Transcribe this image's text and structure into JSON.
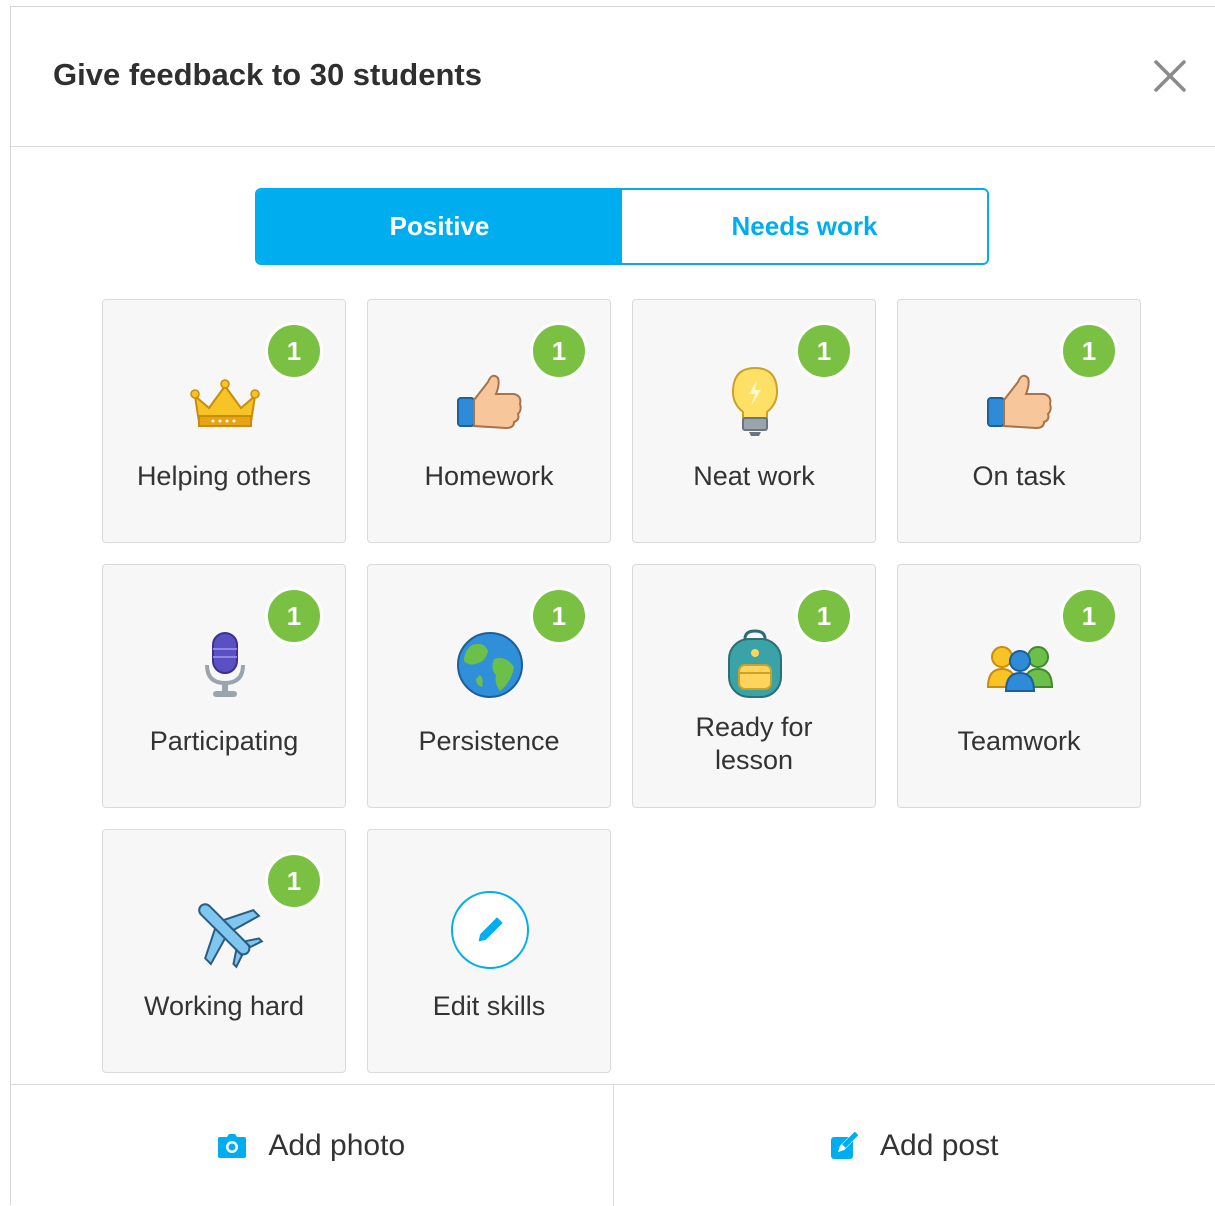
{
  "dialog": {
    "title": "Give feedback to 30 students"
  },
  "tabs": {
    "positive_label": "Positive",
    "needs_work_label": "Needs work",
    "active": "Positive"
  },
  "skills": [
    {
      "label": "Helping others",
      "icon": "crown-icon",
      "count": "1"
    },
    {
      "label": "Homework",
      "icon": "thumbs-up-icon",
      "count": "1"
    },
    {
      "label": "Neat work",
      "icon": "lightbulb-icon",
      "count": "1"
    },
    {
      "label": "On task",
      "icon": "thumbs-up-icon",
      "count": "1"
    },
    {
      "label": "Participating",
      "icon": "microphone-icon",
      "count": "1"
    },
    {
      "label": "Persistence",
      "icon": "globe-icon",
      "count": "1"
    },
    {
      "label": "Ready for lesson",
      "icon": "backpack-icon",
      "count": "1"
    },
    {
      "label": "Teamwork",
      "icon": "team-icon",
      "count": "1"
    },
    {
      "label": "Working hard",
      "icon": "airplane-icon",
      "count": "1"
    }
  ],
  "edit_skills": {
    "label": "Edit skills",
    "icon": "pencil-icon"
  },
  "footer": {
    "add_photo_label": "Add photo",
    "add_post_label": "Add post"
  },
  "colors": {
    "accent": "#00aeef",
    "badge": "#7ac143",
    "tile_bg": "#f7f7f7"
  }
}
